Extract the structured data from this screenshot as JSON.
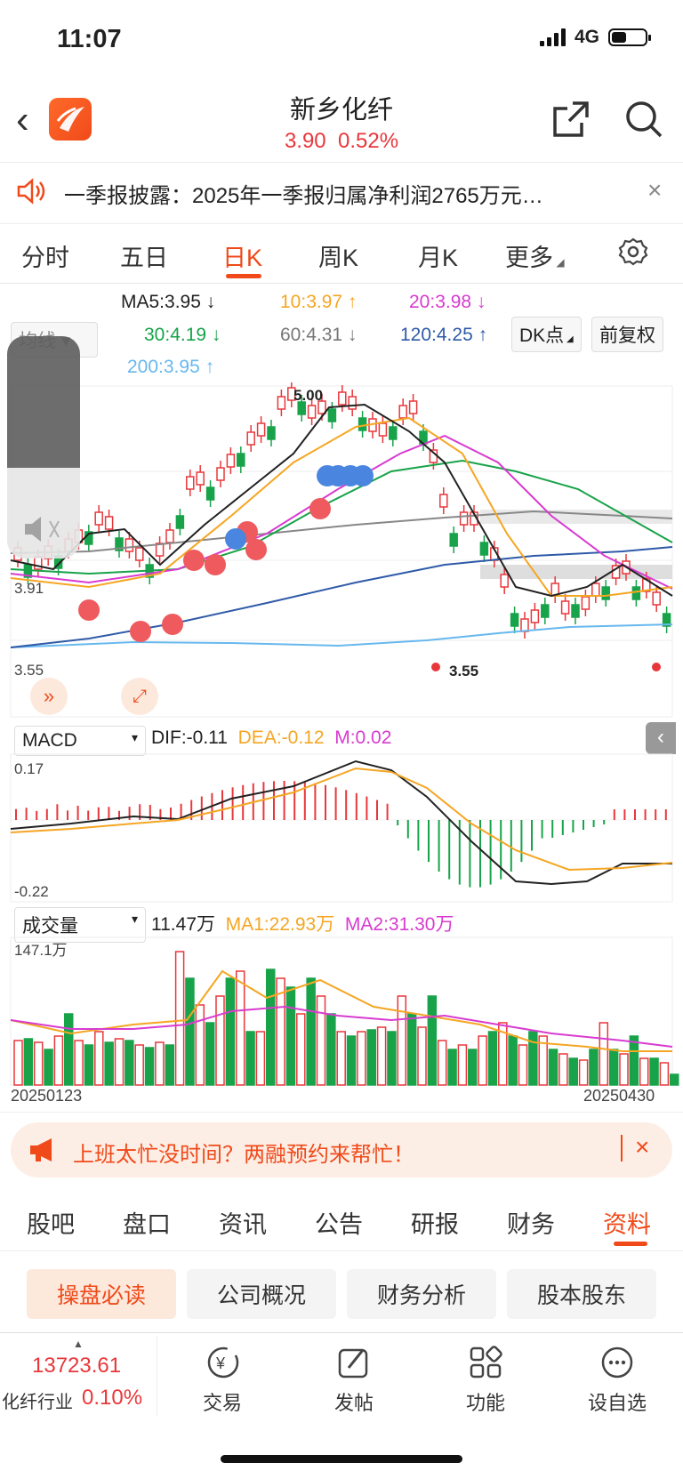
{
  "status": {
    "time": "11:07",
    "network": "4G"
  },
  "header": {
    "name": "新乡化纤",
    "price": "3.90",
    "change": "0.52%"
  },
  "notice": {
    "text": "一季报披露：2025年一季报归属净利润2765万元…"
  },
  "ktabs": [
    {
      "label": "分时"
    },
    {
      "label": "五日"
    },
    {
      "label": "日K"
    },
    {
      "label": "周K"
    },
    {
      "label": "月K"
    },
    {
      "label": "更多"
    }
  ],
  "ma_legend": {
    "ma5": "MA5:3.95",
    "ma10": "10:3.97",
    "ma20": "20:3.98",
    "ma30": "30:4.19",
    "ma60": "60:4.31",
    "ma120": "120:4.25",
    "ma200": "200:3.95",
    "dk": "DK点",
    "fq": "前复权",
    "indicator": "均线",
    "colors": {
      "ma5": "#222222",
      "ma10": "#f5a623",
      "ma20": "#d83bd0",
      "ma30": "#18a34a",
      "ma60": "#888888",
      "ma120": "#2f5aa8",
      "ma200": "#67b8ee"
    }
  },
  "kchart": {
    "high_label": "5.00",
    "low_label": "3.55",
    "y_top_label": "3.91",
    "y_bottom_label": "3.55"
  },
  "macd": {
    "name": "MACD",
    "dif": "DIF:-0.11",
    "dea": "DEA:-0.12",
    "m": "M:0.02",
    "ymax": "0.17",
    "ymin": "-0.22"
  },
  "volume": {
    "name": "成交量",
    "vol": "11.47万",
    "ma1": "MA1:22.93万",
    "ma2": "MA2:31.30万",
    "ymax": "147.1万",
    "start_date": "20250123",
    "end_date": "20250430"
  },
  "promo": {
    "text": "上班太忙没时间？两融预约来帮忙！"
  },
  "btabs": [
    {
      "label": "股吧"
    },
    {
      "label": "盘口"
    },
    {
      "label": "资讯"
    },
    {
      "label": "公告"
    },
    {
      "label": "研报"
    },
    {
      "label": "财务"
    },
    {
      "label": "资料"
    }
  ],
  "chips": [
    {
      "label": "操盘必读"
    },
    {
      "label": "公司概况"
    },
    {
      "label": "财务分析"
    },
    {
      "label": "股本股东"
    }
  ],
  "bottom": {
    "index_value": "13723.61",
    "index_name": "化纤行业",
    "index_change": "0.10%",
    "nav": [
      {
        "label": "交易"
      },
      {
        "label": "发帖"
      },
      {
        "label": "功能"
      },
      {
        "label": "设自选"
      }
    ]
  }
}
